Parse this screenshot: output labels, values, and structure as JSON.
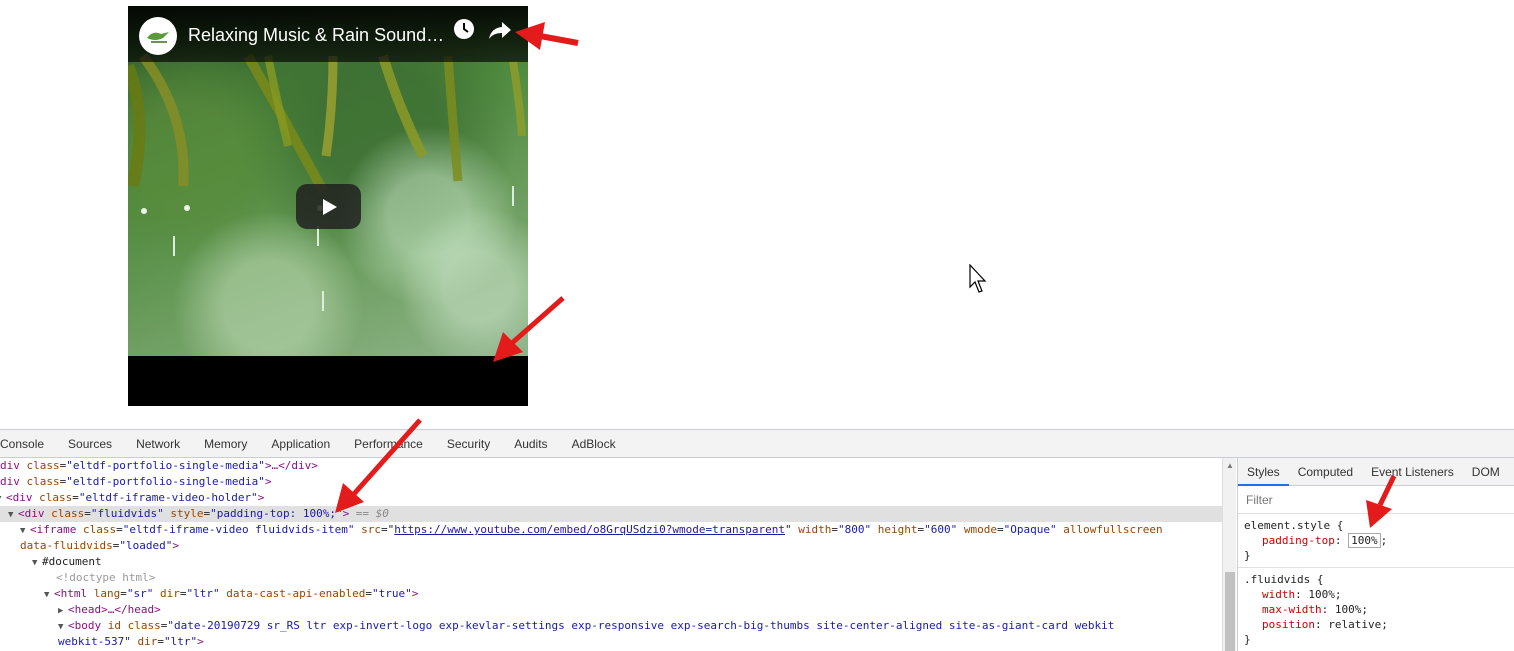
{
  "video": {
    "title": "Relaxing Music & Rain Sounds - Beautiful Piano Music",
    "icons": {
      "channel": "bird-logo-icon",
      "watch_later": "clock-icon",
      "share": "share-arrow-icon",
      "play": "play-icon"
    }
  },
  "devtools": {
    "tabs": [
      "Console",
      "Sources",
      "Network",
      "Memory",
      "Application",
      "Performance",
      "Security",
      "Audits",
      "AdBlock"
    ],
    "elements": {
      "l1": {
        "tag_open": "div ",
        "attr": "class",
        "val": "\"eltdf-portfolio-single-media\"",
        "rest": ">…</div>"
      },
      "l2": {
        "tag_open": "div ",
        "attr": "class",
        "val": "\"eltdf-portfolio-single-media\"",
        "rest": ">"
      },
      "l3": {
        "tag_open": "<div ",
        "attr": "class",
        "val": "\"eltdf-iframe-video-holder\"",
        "rest": ">"
      },
      "l4": {
        "tag_open": "<div ",
        "attr": "class",
        "val": "\"fluidvids\"",
        "attr2": "style",
        "val2": "\"padding-top: 100%;\"",
        "rest": ">",
        "eq": " == $0"
      },
      "l5": {
        "tag_open": "<iframe ",
        "attr": "class",
        "val": "\"eltdf-iframe-video fluidvids-item\"",
        "attr2": "src",
        "link": "https://www.youtube.com/embed/o8GrqUSdzi0?wmode=transparent",
        "attr3": "width",
        "val3": "\"800\"",
        "attr4": "height",
        "val4": "\"600\"",
        "attr5": "wmode",
        "val5": "\"Opaque\"",
        "attr6": "allowfullscreen"
      },
      "l6": {
        "attr": "data-fluidvids",
        "val": "\"loaded\"",
        "rest": ">"
      },
      "l7": {
        "text": "#document"
      },
      "l8": {
        "text": "<!doctype html>"
      },
      "l9": {
        "tag_open": "<html ",
        "attr": "lang",
        "val": "\"sr\"",
        "attr2": "dir",
        "val2": "\"ltr\"",
        "attr3": "data-cast-api-enabled",
        "val3": "\"true\"",
        "rest": ">"
      },
      "l10": {
        "text": "<head>…</head>"
      },
      "l11": {
        "tag_open": "<body ",
        "attr": "id class",
        "val": "\"date-20190729 sr_RS ltr  exp-invert-logo exp-kevlar-settings exp-responsive exp-search-big-thumbs   site-center-aligned site-as-giant-card  webkit"
      },
      "l12": {
        "val": "webkit-537\"",
        "attr": "dir",
        "val2": "\"ltr\"",
        "rest": ">"
      }
    },
    "styles": {
      "tabs": [
        "Styles",
        "Computed",
        "Event Listeners",
        "DOM"
      ],
      "filter_placeholder": "Filter",
      "rule1": {
        "selector": "element.style {",
        "prop": "padding-top",
        "value": "100%",
        "close": "}"
      },
      "rule2": {
        "selector": ".fluidvids {",
        "props": [
          {
            "name": "width",
            "value": "100%"
          },
          {
            "name": "max-width",
            "value": "100%"
          },
          {
            "name": "position",
            "value": "relative"
          }
        ],
        "close": "}"
      }
    }
  },
  "colors": {
    "annotation": "#e31b1b",
    "selection": "#e0e0e0"
  }
}
